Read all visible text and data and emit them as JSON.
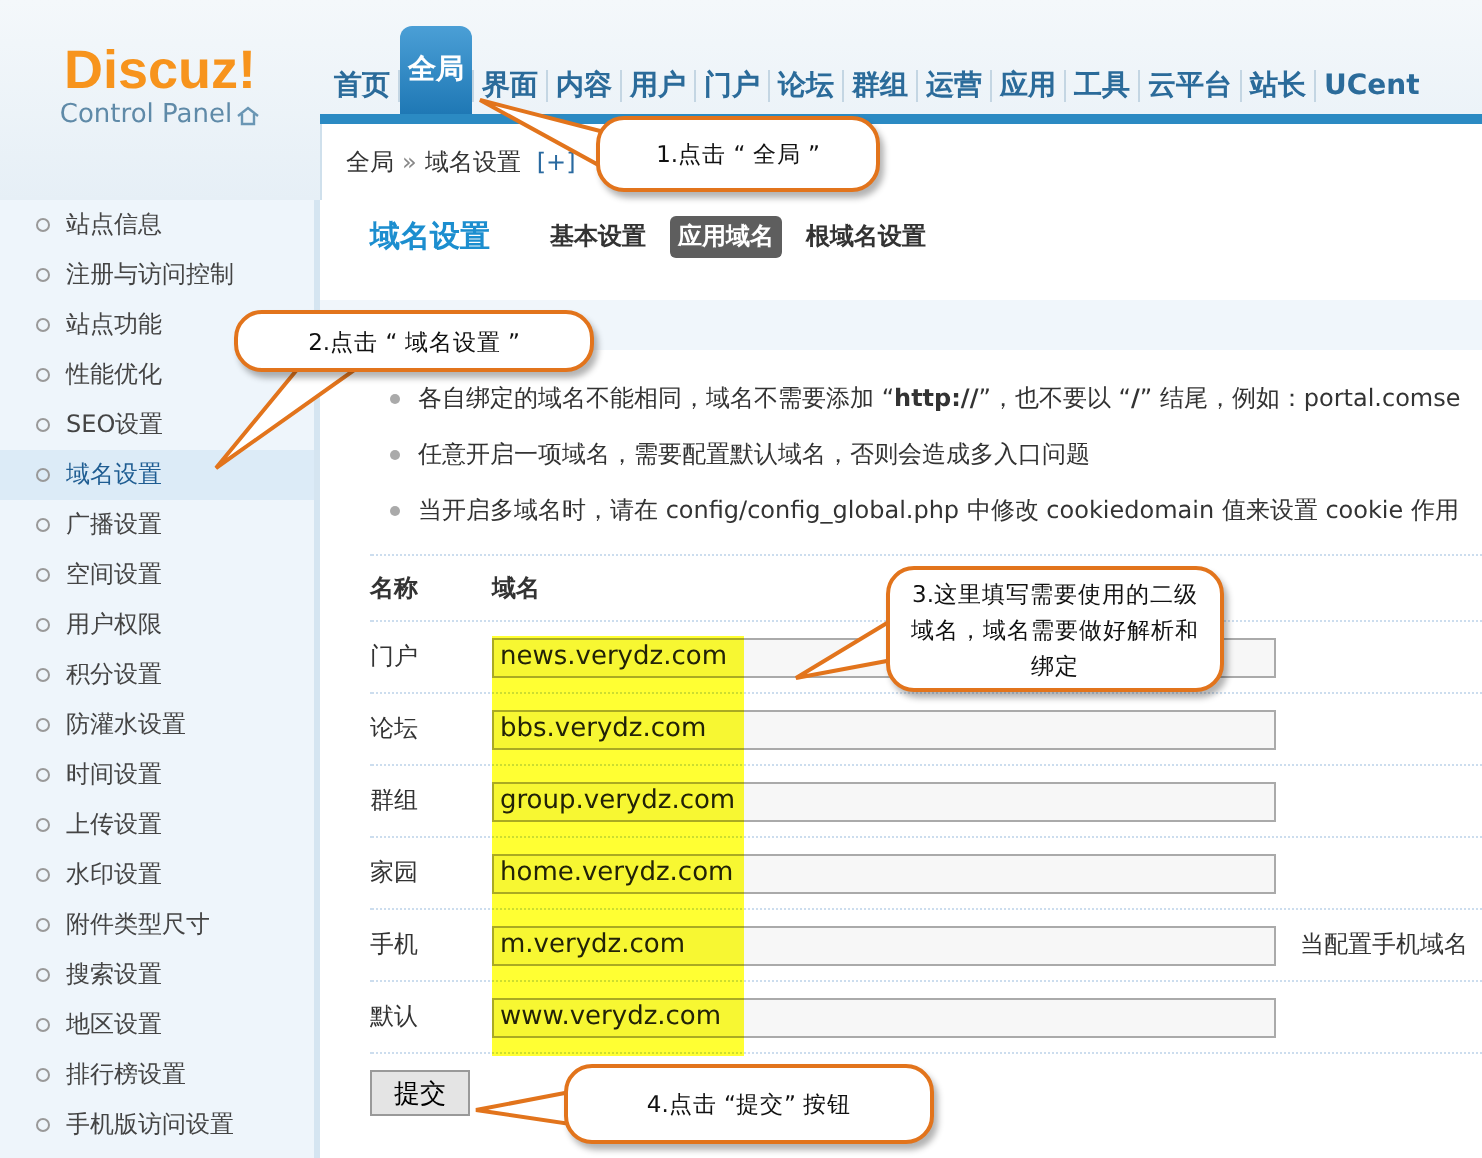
{
  "logo": {
    "name": "Discuz!",
    "subtitle": "Control Panel"
  },
  "nav": [
    {
      "label": "首页",
      "selected": false
    },
    {
      "label": "全局",
      "selected": true
    },
    {
      "label": "界面",
      "selected": false
    },
    {
      "label": "内容",
      "selected": false
    },
    {
      "label": "用户",
      "selected": false
    },
    {
      "label": "门户",
      "selected": false
    },
    {
      "label": "论坛",
      "selected": false
    },
    {
      "label": "群组",
      "selected": false
    },
    {
      "label": "运营",
      "selected": false
    },
    {
      "label": "应用",
      "selected": false
    },
    {
      "label": "工具",
      "selected": false
    },
    {
      "label": "云平台",
      "selected": false
    },
    {
      "label": "站长",
      "selected": false
    },
    {
      "label": "UCent",
      "selected": false
    }
  ],
  "breadcrumb": {
    "parent": "全局",
    "separator": "»",
    "current": "域名设置",
    "add": "[+]"
  },
  "sidebar": {
    "items": [
      {
        "label": "站点信息",
        "selected": false
      },
      {
        "label": "注册与访问控制",
        "selected": false
      },
      {
        "label": "站点功能",
        "selected": false
      },
      {
        "label": "性能优化",
        "selected": false
      },
      {
        "label": "SEO设置",
        "selected": false
      },
      {
        "label": "域名设置",
        "selected": true
      },
      {
        "label": "广播设置",
        "selected": false
      },
      {
        "label": "空间设置",
        "selected": false
      },
      {
        "label": "用户权限",
        "selected": false
      },
      {
        "label": "积分设置",
        "selected": false
      },
      {
        "label": "防灌水设置",
        "selected": false
      },
      {
        "label": "时间设置",
        "selected": false
      },
      {
        "label": "上传设置",
        "selected": false
      },
      {
        "label": "水印设置",
        "selected": false
      },
      {
        "label": "附件类型尺寸",
        "selected": false
      },
      {
        "label": "搜索设置",
        "selected": false
      },
      {
        "label": "地区设置",
        "selected": false
      },
      {
        "label": "排行榜设置",
        "selected": false
      },
      {
        "label": "手机版访问设置",
        "selected": false
      }
    ]
  },
  "page_title": "域名设置",
  "tabs": [
    {
      "label": "基本设置",
      "selected": false
    },
    {
      "label": "应用域名",
      "selected": true
    },
    {
      "label": "根域名设置",
      "selected": false
    }
  ],
  "tips": [
    "各自绑定的域名不能相同，域名不需要添加 “**http://**”，也不要以 “**/**” 结尾，例如：portal.comse",
    "任意开启一项域名，需要配置默认域名，否则会造成多入口问题",
    "当开启多域名时，请在 config/config_global.php 中修改 cookiedomain 值来设置 cookie 作用"
  ],
  "table": {
    "columns": [
      "名称",
      "域名"
    ],
    "rows": [
      {
        "name": "门户",
        "value": "news.verydz.com"
      },
      {
        "name": "论坛",
        "value": "bbs.verydz.com"
      },
      {
        "name": "群组",
        "value": "group.verydz.com"
      },
      {
        "name": "家园",
        "value": "home.verydz.com"
      },
      {
        "name": "手机",
        "value": "m.verydz.com",
        "note": "当配置手机域名"
      },
      {
        "name": "默认",
        "value": "www.verydz.com"
      }
    ]
  },
  "submit": "提交",
  "callouts": [
    "1.点击 “ 全局 ”",
    "2.点击 “ 域名设置 ”",
    "3.这里填写需要使用的二级域名，域名需要做好解析和绑定",
    "4.点击 “提交” 按钮"
  ]
}
